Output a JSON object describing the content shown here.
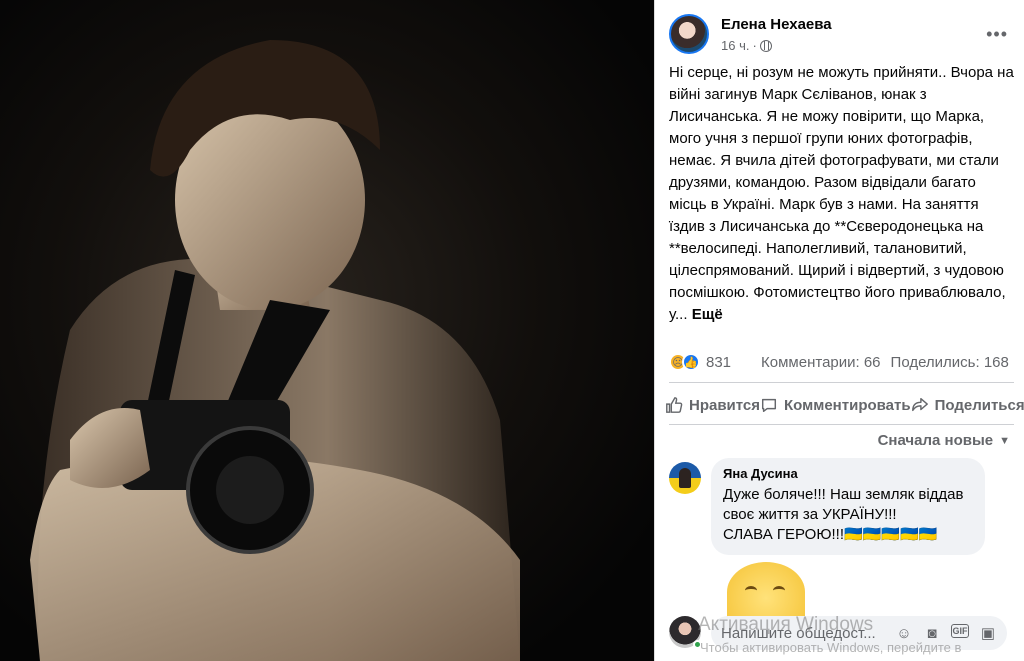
{
  "post": {
    "author": "Елена Нехаева",
    "time": "16 ч.",
    "dot": "·",
    "more_icon": "more-horizontal-icon",
    "text": "Ні серце, ні розум не можуть прийняти.. Вчора на війні загинув Марк Сєліванов, юнак з Лисичанська. Я не можу повірити, що Марка, мого учня з першої групи юних фотографів, немає. Я вчила дітей фотографувати, ми стали друзями, командою. Разом відвідали багато місць в Україні. Марк був з нами. На заняття їздив з Лисичанська до **Сєверодонецька на **велосипеді. Наполегливий, талановитий, цілеспрямований. Щирий і відвертий, з чудовою посмішкою. Фотомистецтво його приваблювало, у...",
    "see_more": "Ещё"
  },
  "stats": {
    "reaction_count": "831",
    "comments": "Комментарии: 66",
    "shares": "Поделились: 168"
  },
  "actions": {
    "like": "Нравится",
    "comment": "Комментировать",
    "share": "Поделиться"
  },
  "sort_label": "Сначала новые",
  "comment1": {
    "name": "Яна Дусина",
    "line1": "Дуже боляче!!! Наш земляк віддав своє життя за УКРАЇНУ!!!",
    "line2": "СЛАВА ГЕРОЮ!!!🇺🇦🇺🇦🇺🇦🇺🇦🇺🇦"
  },
  "composer": {
    "placeholder": "Напишите общедост..."
  },
  "watermark": {
    "title": "Активация Windows",
    "subtitle": "Чтобы активировать Windows, перейдите в"
  },
  "colors": {
    "accent": "#1877f2",
    "secondary_text": "#65676b",
    "bubble": "#f0f2f5"
  }
}
